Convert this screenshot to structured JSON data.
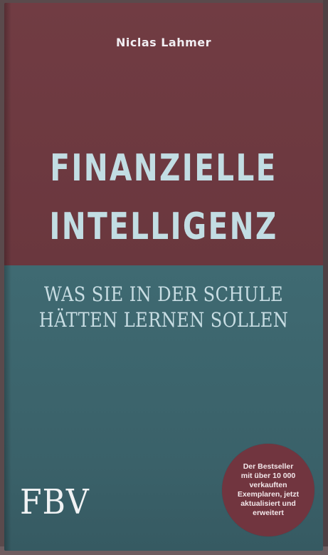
{
  "cover": {
    "author": "Niclas Lahmer",
    "title_line_1": "FINANZIELLE",
    "title_line_2": "INTELLIGENZ",
    "subtitle_line_1": "WAS SIE IN DER SCHULE",
    "subtitle_line_2": "HÄTTEN LERNEN SOLLEN",
    "publisher": "FBV",
    "badge_lines": [
      "Der Bestseller",
      "mit über 10 000",
      "verkauften",
      "Exemplaren, jetzt",
      "aktualisiert und",
      "erweitert"
    ]
  },
  "colors": {
    "top_panel": "#713c43",
    "bottom_panel": "#3f6a72",
    "title_text": "#c2dde3",
    "badge": "#71353f"
  }
}
